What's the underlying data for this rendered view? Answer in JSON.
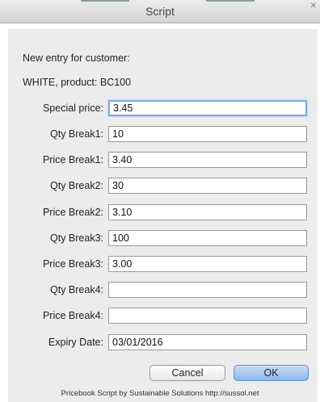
{
  "window": {
    "title": "Script"
  },
  "intro": {
    "line1": "New entry for customer:",
    "line2": "WHITE, product: BC100"
  },
  "fields": [
    {
      "label": "Special price:",
      "value": "3.45"
    },
    {
      "label": "Qty Break1:",
      "value": "10"
    },
    {
      "label": "Price Break1:",
      "value": "3.40"
    },
    {
      "label": "Qty Break2:",
      "value": "30"
    },
    {
      "label": "Price Break2:",
      "value": "3.10"
    },
    {
      "label": "Qty Break3:",
      "value": "100"
    },
    {
      "label": "Price Break3:",
      "value": "3.00"
    },
    {
      "label": "Qty Break4:",
      "value": ""
    },
    {
      "label": "Price Break4:",
      "value": ""
    },
    {
      "label": "Expiry Date:",
      "value": "03/01/2016"
    }
  ],
  "buttons": {
    "cancel": "Cancel",
    "ok": "OK"
  },
  "footer": "Pricebook Script by Sustainable Solutions http://sussol.net"
}
